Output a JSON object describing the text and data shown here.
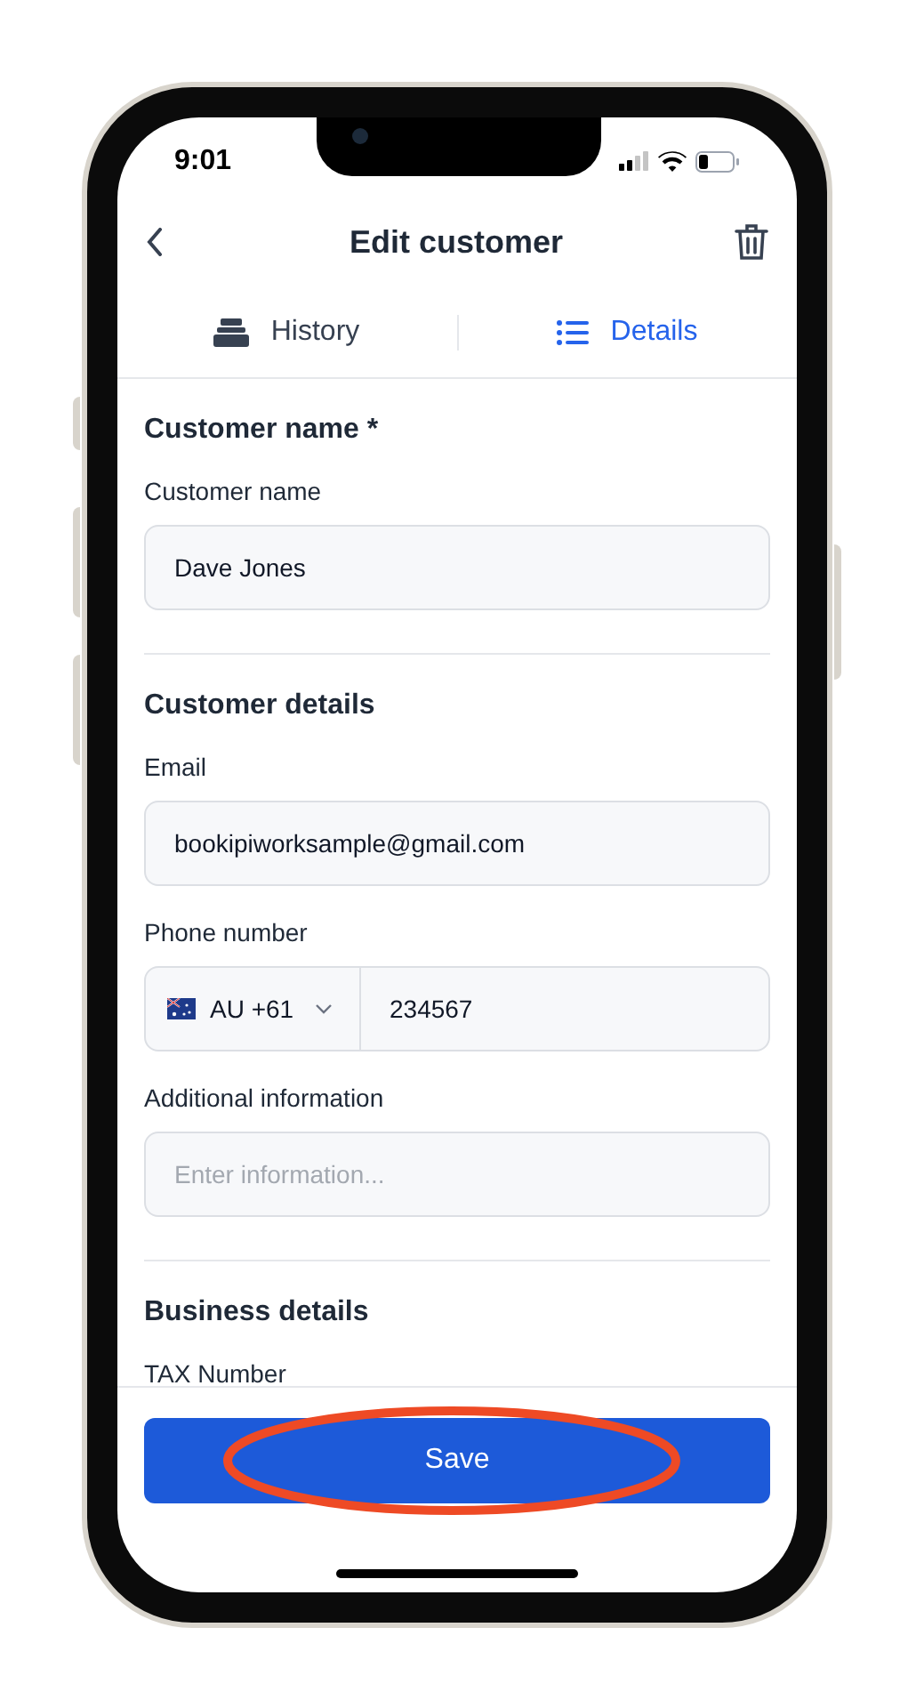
{
  "status_bar": {
    "time": "9:01"
  },
  "header": {
    "title": "Edit customer"
  },
  "tabs": [
    {
      "label": "History",
      "kind": "stack",
      "selected": false
    },
    {
      "label": "Details",
      "kind": "list",
      "selected": true
    }
  ],
  "sections": [
    {
      "title": "Customer name *",
      "fields": [
        {
          "kind": "text",
          "label": "Customer name",
          "value": "Dave Jones"
        }
      ]
    },
    {
      "title": "Customer details",
      "fields": [
        {
          "kind": "text",
          "label": "Email",
          "value": "bookipiworksample@gmail.com"
        },
        {
          "kind": "phone",
          "label": "Phone number",
          "country": "AU +61",
          "value": "234567"
        },
        {
          "kind": "text",
          "label": "Additional information",
          "placeholder": "Enter information..."
        }
      ]
    },
    {
      "title": "Business details",
      "fields": [
        {
          "kind": "label_only",
          "label": "TAX Number"
        }
      ]
    }
  ],
  "save_button": {
    "label": "Save",
    "circled": true
  }
}
